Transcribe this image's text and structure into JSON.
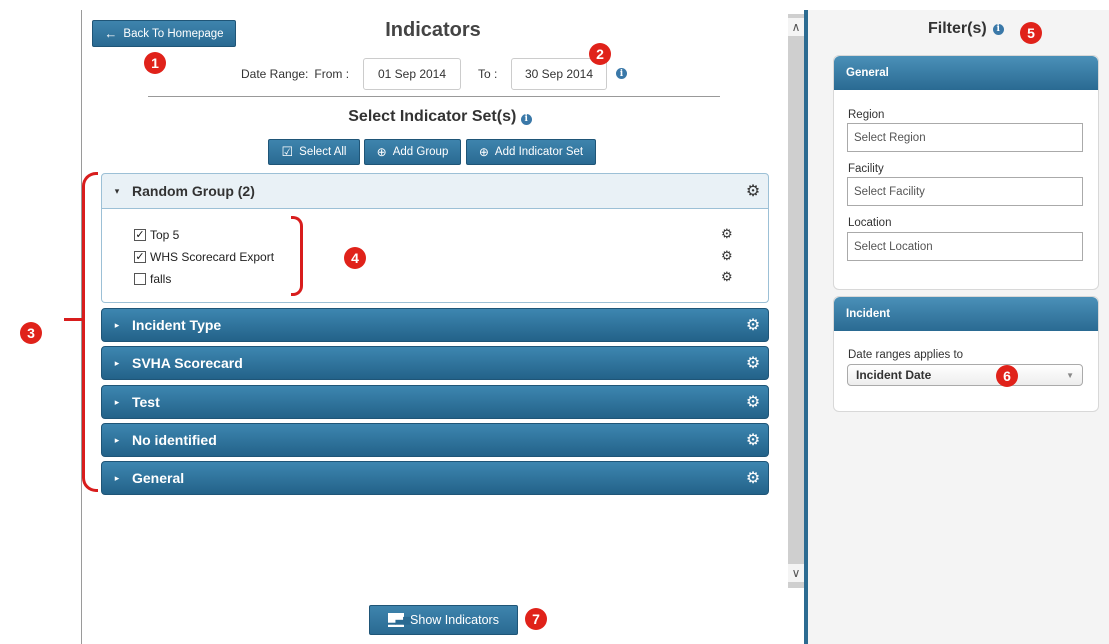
{
  "header": {
    "back_label": "Back To Homepage",
    "title": "Indicators"
  },
  "date_range": {
    "label": "Date Range:",
    "from_label": "From :",
    "from_value": "01 Sep 2014",
    "to_label": "To :",
    "to_value": "30 Sep 2014"
  },
  "indicator_sets": {
    "title": "Select Indicator Set(s)",
    "select_all": "Select All",
    "add_group": "Add Group",
    "add_set": "Add Indicator Set"
  },
  "groups": [
    {
      "title": "Random Group (2)",
      "expanded": true,
      "items": [
        {
          "label": "Top 5",
          "checked": true
        },
        {
          "label": "WHS Scorecard Export",
          "checked": true
        },
        {
          "label": "falls",
          "checked": false
        }
      ]
    },
    {
      "title": "Incident Type",
      "expanded": false
    },
    {
      "title": "SVHA Scorecard",
      "expanded": false
    },
    {
      "title": "Test",
      "expanded": false
    },
    {
      "title": "No identified",
      "expanded": false
    },
    {
      "title": "General",
      "expanded": false
    }
  ],
  "show_indicators": "Show Indicators",
  "filters": {
    "title": "Filter(s)",
    "general": {
      "head": "General",
      "region_label": "Region",
      "region_placeholder": "Select Region",
      "facility_label": "Facility",
      "facility_placeholder": "Select Facility",
      "location_label": "Location",
      "location_placeholder": "Select Location"
    },
    "incident": {
      "head": "Incident",
      "date_label": "Date ranges applies to",
      "date_value": "Incident Date"
    }
  },
  "callouts": [
    "1",
    "2",
    "3",
    "4",
    "5",
    "6",
    "7"
  ],
  "colors": {
    "accent": "#2a6a92",
    "callout": "#e0221a"
  }
}
